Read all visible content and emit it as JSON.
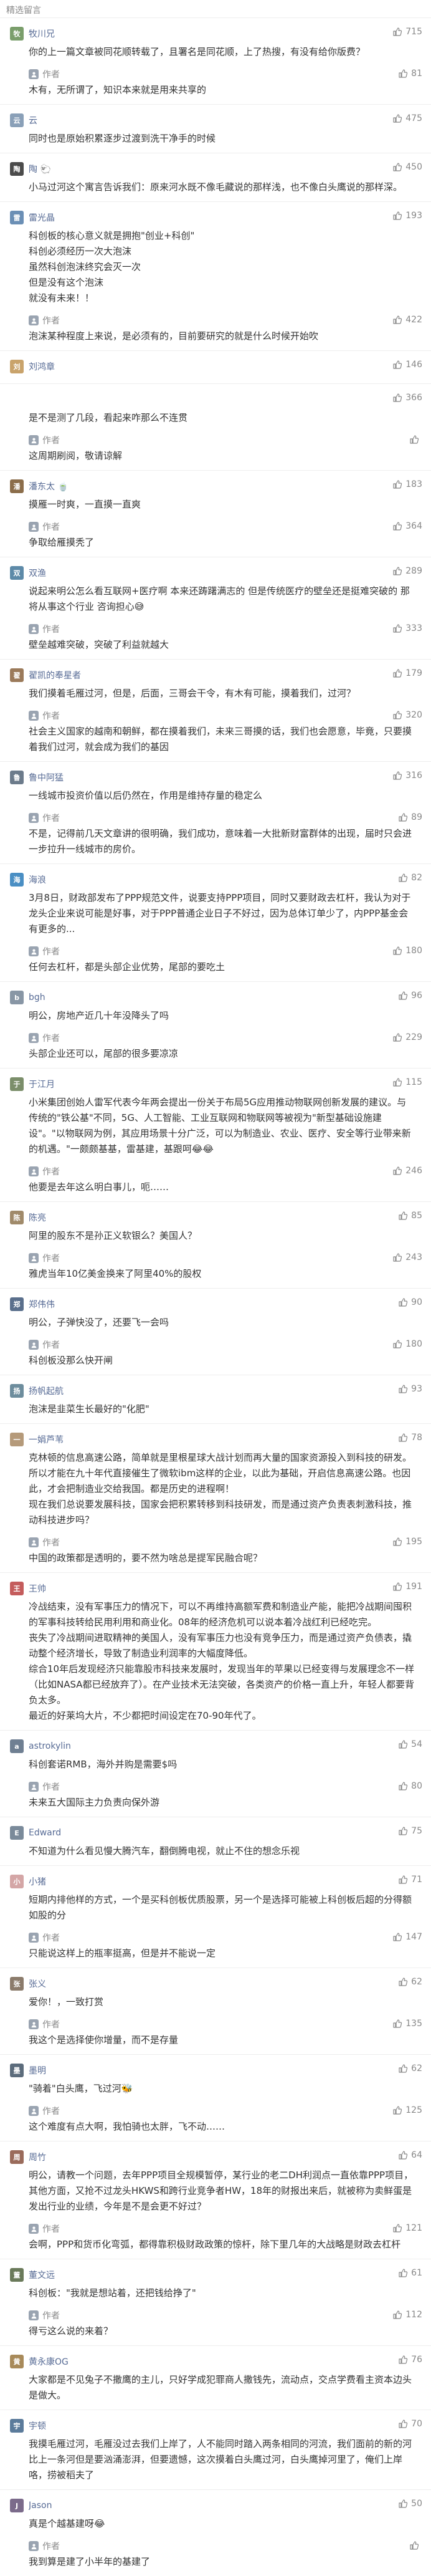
{
  "section_title": "精选留言",
  "author_label": "作者",
  "comments": [
    {
      "nickname": "牧川兄",
      "avatar_color": "#7a9e6b",
      "avatar_char": "牧",
      "text": "你的上一篇文章被同花顺转载了，且署名是同花顺，上了热搜，有没有给你版费？",
      "likes": "715",
      "reply": {
        "text": "木有，无所谓了，知识本来就是用来共享的",
        "likes": "81"
      }
    },
    {
      "nickname": "云",
      "avatar_color": "#8aa0b8",
      "avatar_char": "云",
      "text": "同时也是原始积累逐步过渡到洗干净手的时候",
      "likes": "475",
      "reply": null
    },
    {
      "nickname": "陶 🐑",
      "avatar_color": "#4b4b4b",
      "avatar_char": "陶",
      "text": "小马过河这个寓言告诉我们：原来河水既不像毛藏说的那样浅，也不像白头鹰说的那样深。",
      "likes": "450",
      "reply": null
    },
    {
      "nickname": "雷光晶",
      "avatar_color": "#6b8fb5",
      "avatar_char": "雷",
      "text": "科创板的核心意义就是拥抱\"创业+科创\"\n科创必须经历一次大泡沫\n虽然科创泡沫终究会灭一次\n但是没有这个泡沫\n就没有未来！！",
      "likes": "193",
      "reply": {
        "text": "泡沫某种程度上来说，是必须有的，目前要研究的就是什么时候开始吹",
        "likes": "422"
      }
    },
    {
      "nickname": "刘鸿章",
      "avatar_color": "#c9a36b",
      "avatar_char": "刘",
      "text": "",
      "likes": "146",
      "reply": null
    },
    {
      "nickname": "",
      "avatar_color": "#ffffff",
      "avatar_char": "",
      "text": "是不是测了几段，看起来咋那么不连贯",
      "likes": "366",
      "reply": {
        "text": "这周期刷阅，敬请谅解",
        "likes": ""
      }
    },
    {
      "nickname": "潘东太 🍵",
      "avatar_color": "#8b6d4a",
      "avatar_char": "潘",
      "text": "摸雁一时爽，一直摸一直爽",
      "likes": "183",
      "reply": {
        "text": "争取给雁摸秃了",
        "likes": "364"
      }
    },
    {
      "nickname": "双渔",
      "avatar_color": "#5d8aa8",
      "avatar_char": "双",
      "text": "说起来明公怎么看互联网+医疗啊 本来还踌躇满志的 但是传统医疗的壁垒还是挺难突破的 那将从事这个行业 咨询担心😅",
      "likes": "289",
      "reply": {
        "text": "壁垒越难突破，突破了利益就越大",
        "likes": "333"
      }
    },
    {
      "nickname": "翟凯的奉星者",
      "avatar_color": "#9b7a5a",
      "avatar_char": "翟",
      "text": "我们摸着毛雁过河，但是，后面，三哥会干令，有木有可能，摸着我们，过河？",
      "likes": "179",
      "reply": {
        "text": "社会主义国家的越南和朝鲜，都在摸着我们，未来三哥摸的话，我们也会愿意，毕竟，只要摸着我们过河，就会成为我们的基因",
        "likes": "320"
      }
    },
    {
      "nickname": "鲁中阿猛",
      "avatar_color": "#6c7b8b",
      "avatar_char": "鲁",
      "text": "一线城市投资价值以后仍然在，作用是维持存量的稳定么",
      "likes": "316",
      "reply": {
        "text": "不是，记得前几天文章讲的很明确，我们成功，意味着一大批新财富群体的出现，届时只会进一步拉升一线城市的房价。",
        "likes": "89"
      }
    },
    {
      "nickname": "海浪",
      "avatar_color": "#4a8fc4",
      "avatar_char": "海",
      "text": "3月8日，财政部发布了PPP规范文件，说要支持PPP项目，同时又要财政去杠杆，我认为对于龙头企业来说可能是好事，对于PPP普通企业日子不好过，因为总体订单少了，内PPP基金会有更多的...",
      "likes": "82",
      "reply": {
        "text": "任何去杠杆，都是头部企业优势，尾部的要吃土",
        "likes": "180"
      }
    },
    {
      "nickname": "bgh",
      "avatar_color": "#8896a5",
      "avatar_char": "b",
      "text": "明公，房地产近几十年没降头了吗",
      "likes": "96",
      "reply": {
        "text": "头部企业还可以，尾部的很多要凉凉",
        "likes": "229"
      }
    },
    {
      "nickname": "于江月",
      "avatar_color": "#7b8e6a",
      "avatar_char": "于",
      "text": "小米集团创始人雷军代表今年两会提出一份关于布局5G应用推动物联网创新发展的建议。与传统的\"铁公基\"不同，5G、人工智能、工业互联网和物联网等被视为\"新型基础设施建设\"。\"以物联网为例，其应用场景十分广泛，可以为制造业、农业、医疗、安全等行业带来新的机遇。\"一颇颇基基，雷基建，基跟呵😂😂",
      "likes": "115",
      "reply": {
        "text": "他要是去年这么明白事儿，呃……",
        "likes": "246"
      }
    },
    {
      "nickname": "陈亮",
      "avatar_color": "#a08a6a",
      "avatar_char": "陈",
      "text": "阿里的股东不是孙正义软银么？美国人？",
      "likes": "85",
      "reply": {
        "text": "雅虎当年10亿美金换来了阿里40%的股权",
        "likes": "243"
      }
    },
    {
      "nickname": "郑伟伟",
      "avatar_color": "#5a6f8c",
      "avatar_char": "郑",
      "text": "明公，子弹快没了，还要飞一会吗",
      "likes": "90",
      "reply": {
        "text": "科创板没那么快开闸",
        "likes": "180"
      }
    },
    {
      "nickname": "扬帆起航",
      "avatar_color": "#6d8d9d",
      "avatar_char": "扬",
      "text": "泡沫是韭菜生长最好的\"化肥\"",
      "likes": "93",
      "reply": null
    },
    {
      "nickname": "一娟芦苇",
      "avatar_color": "#b59a7a",
      "avatar_char": "一",
      "text": "克林顿的信息高速公路，简单就是里根星球大战计划而再大量的国家资源投入到科技的研发。所以才能在九十年代直接催生了微软ibm这样的企业，以此为基础，开启信息高速公路。也因此，才会把制造业交给我国。都是历史的进程啊！\n现在我们总说要发展科技，国家会把积累转移到科技研发，而是通过资产负责表刺激科技，推动科技进步吗？",
      "likes": "78",
      "reply": {
        "text": "中国的政策都是透明的，要不然为啥总是提军民融合呢？",
        "likes": "195"
      }
    },
    {
      "nickname": "王帅",
      "avatar_color": "#c45c5c",
      "avatar_char": "王",
      "text": "冷战结束，没有军事压力的情况下，可以不再维持高额军费和制造业产能，能把冷战期间囤积的军事科技转给民用利用和商业化。08年的经济危机可以说本着冷战红利已经吃完。\n丧失了冷战期间进取精神的美国人，没有军事压力也没有竞争压力，而是通过资产负债表，撬动整个经济增长，导致了制造业利润率的大幅度降低。\n综合10年后发现经济只能靠股市科技来发展时，发现当年的苹果以已经变得与发展理念不一样（比如NASA都已经放弃了）。在产业技术无法突破，各类资产的价格一直上升，年轻人都要背负太多。\n最近的好莱坞大片，不少都把时间设定在70-90年代了。",
      "likes": "191",
      "reply": null
    },
    {
      "nickname": "astrokylin",
      "avatar_color": "#6f7f92",
      "avatar_char": "a",
      "text": "科创套诺RMB，海外并购是需要$吗",
      "likes": "54",
      "reply": {
        "text": "未来五大国际主力负责向保外游",
        "likes": "80"
      }
    },
    {
      "nickname": "Edward",
      "avatar_color": "#7a8a9a",
      "avatar_char": "E",
      "text": "不知道为什么看见慢大腾汽车，翻倒腾电视，就止不住的想念乐视",
      "likes": "75",
      "reply": null
    },
    {
      "nickname": "小猪",
      "avatar_color": "#d4a6a6",
      "avatar_char": "小",
      "text": "短期内排他样的方式，一个是买科创板优质股票，另一个是选择可能被上科创板后超的分得额如股的分",
      "likes": "71",
      "reply": {
        "text": "只能说这样上的瓶率挺高，但是并不能说一定",
        "likes": "147"
      }
    },
    {
      "nickname": "张义",
      "avatar_color": "#8b7b6b",
      "avatar_char": "张",
      "text": "爱你！，一致打赏",
      "likes": "62",
      "reply": {
        "text": "我这个是选择使你增量，而不是存量",
        "likes": "135"
      }
    },
    {
      "nickname": "墨明",
      "avatar_color": "#5c6c7c",
      "avatar_char": "墨",
      "text": "\"骑着\"白头鹰，飞过河🐝",
      "likes": "62",
      "reply": {
        "text": "这个难度有点大啊，我怕骑也太胖，飞不动……",
        "likes": "125"
      }
    },
    {
      "nickname": "周竹",
      "avatar_color": "#9a6b5b",
      "avatar_char": "周",
      "text": "明公，请教一个问题，去年PPP项目全规模暂停，某行业的老二DH利润点一直依靠PPP项目，其他方面，又抢不过龙头HKWS和跨行业竞争者HW，18年的财报出来后，就被称为卖鲜蛋是发出行业的业绩，今年是不是会更不好过？",
      "likes": "64",
      "reply": {
        "text": "会啊，PPP和货币化弯弧，都得靠积极财政政策的惊杆，除下里几年的大战略是财政去杠杆",
        "likes": "121"
      }
    },
    {
      "nickname": "董文远",
      "avatar_color": "#6a7a5a",
      "avatar_char": "董",
      "text": "科创板：\"我就是想站着，还把钱给挣了\"",
      "likes": "61",
      "reply": {
        "text": "得亏这么说的来着？",
        "likes": "112"
      }
    },
    {
      "nickname": "黄永康OG",
      "avatar_color": "#a88a5a",
      "avatar_char": "黄",
      "text": "大家都是不见兔子不撒鹰的主儿，只好学成犯罪商人撒钱先，流动点，交点学费看主资本边头是做大。",
      "likes": "76",
      "reply": null
    },
    {
      "nickname": "宇顿",
      "avatar_color": "#5b7b9b",
      "avatar_char": "宇",
      "text": "我摸毛雁过河，毛雁没过去我们上岸了，人不能同时踏入两条相同的河流，我们面前的新的河比上一条河但是要汹涌澎湃，但要遗憾，这次摸着白头鹰过河，白头鹰掉河里了，俺们上岸咯，捞被稻夫了",
      "likes": "70",
      "reply": null
    },
    {
      "nickname": "Jason",
      "avatar_color": "#7b6b8b",
      "avatar_char": "J",
      "text": "真是个越基建呀😂",
      "likes": "50",
      "reply": {
        "text": "我到算是建了小半年的基建了",
        "likes": ""
      }
    }
  ]
}
